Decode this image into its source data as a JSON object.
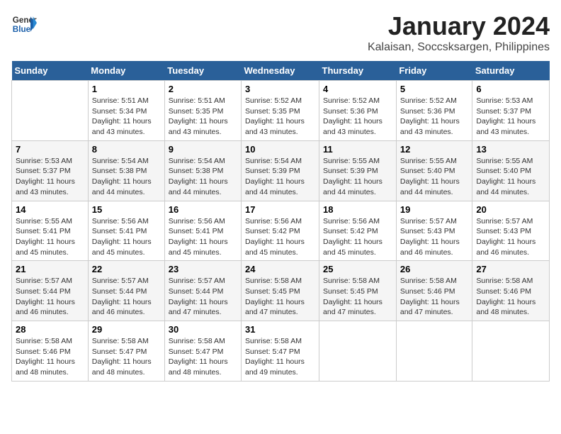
{
  "header": {
    "logo_line1": "General",
    "logo_line2": "Blue",
    "main_title": "January 2024",
    "subtitle": "Kalaisan, Soccsksargen, Philippines"
  },
  "days_of_week": [
    "Sunday",
    "Monday",
    "Tuesday",
    "Wednesday",
    "Thursday",
    "Friday",
    "Saturday"
  ],
  "weeks": [
    [
      {
        "day": "",
        "sunrise": "",
        "sunset": "",
        "daylight": ""
      },
      {
        "day": "1",
        "sunrise": "Sunrise: 5:51 AM",
        "sunset": "Sunset: 5:34 PM",
        "daylight": "Daylight: 11 hours and 43 minutes."
      },
      {
        "day": "2",
        "sunrise": "Sunrise: 5:51 AM",
        "sunset": "Sunset: 5:35 PM",
        "daylight": "Daylight: 11 hours and 43 minutes."
      },
      {
        "day": "3",
        "sunrise": "Sunrise: 5:52 AM",
        "sunset": "Sunset: 5:35 PM",
        "daylight": "Daylight: 11 hours and 43 minutes."
      },
      {
        "day": "4",
        "sunrise": "Sunrise: 5:52 AM",
        "sunset": "Sunset: 5:36 PM",
        "daylight": "Daylight: 11 hours and 43 minutes."
      },
      {
        "day": "5",
        "sunrise": "Sunrise: 5:52 AM",
        "sunset": "Sunset: 5:36 PM",
        "daylight": "Daylight: 11 hours and 43 minutes."
      },
      {
        "day": "6",
        "sunrise": "Sunrise: 5:53 AM",
        "sunset": "Sunset: 5:37 PM",
        "daylight": "Daylight: 11 hours and 43 minutes."
      }
    ],
    [
      {
        "day": "7",
        "sunrise": "Sunrise: 5:53 AM",
        "sunset": "Sunset: 5:37 PM",
        "daylight": "Daylight: 11 hours and 43 minutes."
      },
      {
        "day": "8",
        "sunrise": "Sunrise: 5:54 AM",
        "sunset": "Sunset: 5:38 PM",
        "daylight": "Daylight: 11 hours and 44 minutes."
      },
      {
        "day": "9",
        "sunrise": "Sunrise: 5:54 AM",
        "sunset": "Sunset: 5:38 PM",
        "daylight": "Daylight: 11 hours and 44 minutes."
      },
      {
        "day": "10",
        "sunrise": "Sunrise: 5:54 AM",
        "sunset": "Sunset: 5:39 PM",
        "daylight": "Daylight: 11 hours and 44 minutes."
      },
      {
        "day": "11",
        "sunrise": "Sunrise: 5:55 AM",
        "sunset": "Sunset: 5:39 PM",
        "daylight": "Daylight: 11 hours and 44 minutes."
      },
      {
        "day": "12",
        "sunrise": "Sunrise: 5:55 AM",
        "sunset": "Sunset: 5:40 PM",
        "daylight": "Daylight: 11 hours and 44 minutes."
      },
      {
        "day": "13",
        "sunrise": "Sunrise: 5:55 AM",
        "sunset": "Sunset: 5:40 PM",
        "daylight": "Daylight: 11 hours and 44 minutes."
      }
    ],
    [
      {
        "day": "14",
        "sunrise": "Sunrise: 5:55 AM",
        "sunset": "Sunset: 5:41 PM",
        "daylight": "Daylight: 11 hours and 45 minutes."
      },
      {
        "day": "15",
        "sunrise": "Sunrise: 5:56 AM",
        "sunset": "Sunset: 5:41 PM",
        "daylight": "Daylight: 11 hours and 45 minutes."
      },
      {
        "day": "16",
        "sunrise": "Sunrise: 5:56 AM",
        "sunset": "Sunset: 5:41 PM",
        "daylight": "Daylight: 11 hours and 45 minutes."
      },
      {
        "day": "17",
        "sunrise": "Sunrise: 5:56 AM",
        "sunset": "Sunset: 5:42 PM",
        "daylight": "Daylight: 11 hours and 45 minutes."
      },
      {
        "day": "18",
        "sunrise": "Sunrise: 5:56 AM",
        "sunset": "Sunset: 5:42 PM",
        "daylight": "Daylight: 11 hours and 45 minutes."
      },
      {
        "day": "19",
        "sunrise": "Sunrise: 5:57 AM",
        "sunset": "Sunset: 5:43 PM",
        "daylight": "Daylight: 11 hours and 46 minutes."
      },
      {
        "day": "20",
        "sunrise": "Sunrise: 5:57 AM",
        "sunset": "Sunset: 5:43 PM",
        "daylight": "Daylight: 11 hours and 46 minutes."
      }
    ],
    [
      {
        "day": "21",
        "sunrise": "Sunrise: 5:57 AM",
        "sunset": "Sunset: 5:44 PM",
        "daylight": "Daylight: 11 hours and 46 minutes."
      },
      {
        "day": "22",
        "sunrise": "Sunrise: 5:57 AM",
        "sunset": "Sunset: 5:44 PM",
        "daylight": "Daylight: 11 hours and 46 minutes."
      },
      {
        "day": "23",
        "sunrise": "Sunrise: 5:57 AM",
        "sunset": "Sunset: 5:44 PM",
        "daylight": "Daylight: 11 hours and 47 minutes."
      },
      {
        "day": "24",
        "sunrise": "Sunrise: 5:58 AM",
        "sunset": "Sunset: 5:45 PM",
        "daylight": "Daylight: 11 hours and 47 minutes."
      },
      {
        "day": "25",
        "sunrise": "Sunrise: 5:58 AM",
        "sunset": "Sunset: 5:45 PM",
        "daylight": "Daylight: 11 hours and 47 minutes."
      },
      {
        "day": "26",
        "sunrise": "Sunrise: 5:58 AM",
        "sunset": "Sunset: 5:46 PM",
        "daylight": "Daylight: 11 hours and 47 minutes."
      },
      {
        "day": "27",
        "sunrise": "Sunrise: 5:58 AM",
        "sunset": "Sunset: 5:46 PM",
        "daylight": "Daylight: 11 hours and 48 minutes."
      }
    ],
    [
      {
        "day": "28",
        "sunrise": "Sunrise: 5:58 AM",
        "sunset": "Sunset: 5:46 PM",
        "daylight": "Daylight: 11 hours and 48 minutes."
      },
      {
        "day": "29",
        "sunrise": "Sunrise: 5:58 AM",
        "sunset": "Sunset: 5:47 PM",
        "daylight": "Daylight: 11 hours and 48 minutes."
      },
      {
        "day": "30",
        "sunrise": "Sunrise: 5:58 AM",
        "sunset": "Sunset: 5:47 PM",
        "daylight": "Daylight: 11 hours and 48 minutes."
      },
      {
        "day": "31",
        "sunrise": "Sunrise: 5:58 AM",
        "sunset": "Sunset: 5:47 PM",
        "daylight": "Daylight: 11 hours and 49 minutes."
      },
      {
        "day": "",
        "sunrise": "",
        "sunset": "",
        "daylight": ""
      },
      {
        "day": "",
        "sunrise": "",
        "sunset": "",
        "daylight": ""
      },
      {
        "day": "",
        "sunrise": "",
        "sunset": "",
        "daylight": ""
      }
    ]
  ]
}
